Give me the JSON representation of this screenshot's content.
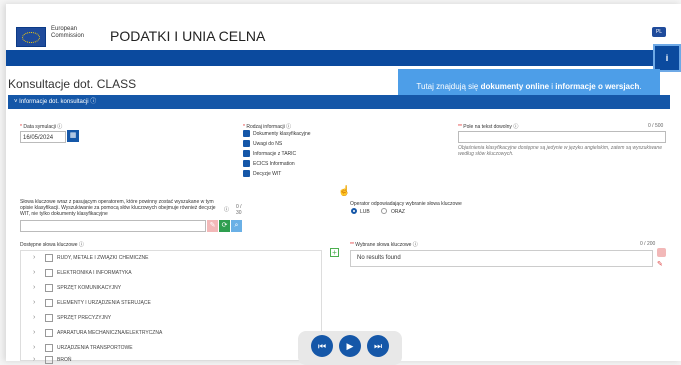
{
  "header": {
    "ec_line1": "European",
    "ec_line2": "Commission",
    "site_title": "PODATKI I UNIA CELNA",
    "lang_badge": "PL"
  },
  "tooltip": {
    "prefix": "Tutaj znajdują się ",
    "bold1": "dokumenty online",
    "middle": " i ",
    "bold2": "informacje o wersjach",
    "suffix": "."
  },
  "page_title": "Konsultacje dot. CLASS",
  "section_title": "Informacje dot. konsultacji",
  "form": {
    "date_label": "Data symulacji",
    "date_value": "16/05/2024",
    "info_type_label": "Rodzaj informacji",
    "info_types": [
      "Dokumenty klasyfikacyjne",
      "Uwagi do NS",
      "Informacje z TARIC",
      "ECICS Information",
      "Decyzje WIT"
    ],
    "free_text_label": "Pole na tekst dowolny",
    "free_text_counter": "0 / 500",
    "free_text_note": "Objaśnienia klasyfikacyjne dostępne są jedynie w języku angielskim, zatem są wyszukiwane według słów kluczowych.",
    "keywords_label": "Słowa kluczowe wraz z pasującym operatorem, które powinny zostać wyszukane w tym opisie klasyfikacji. Wyszukiwanie za pomocą słów kluczowych obejmuje również decyzje WIT, nie tylko dokumenty klasyfikacyjne",
    "keywords_counter": "0 / 30",
    "operator_label": "Operator odpowiadający wybranie słowa kluczowe",
    "operator_or": "LUB",
    "operator_and": "ORAZ",
    "available_label": "Dostępne słowa kluczowe",
    "available_items": [
      "RUDY, METALE I ZWIĄZKI CHEMICZNE",
      "ELEKTRONIKA I INFORMATYKA",
      "SPRZĘT KOMUNIKACYJNY",
      "ELEMENTY I URZĄDZENIA STERUJĄCE",
      "SPRZĘT PRECYZYJNY",
      "APARATURA MECHANICZNA/ELEKTRYCZNA",
      "URZĄDZENIA TRANSPORTOWE",
      "BROŃ"
    ],
    "selected_label": "Wybrane słowa kluczowe",
    "selected_counter": "0 / 200",
    "no_results": "No results found"
  },
  "player": {
    "prev_icon": "⏮",
    "play_icon": "▶",
    "next_icon": "⏭"
  },
  "colors": {
    "primary": "#0b4a9e",
    "tooltip": "#4d9ee8"
  }
}
